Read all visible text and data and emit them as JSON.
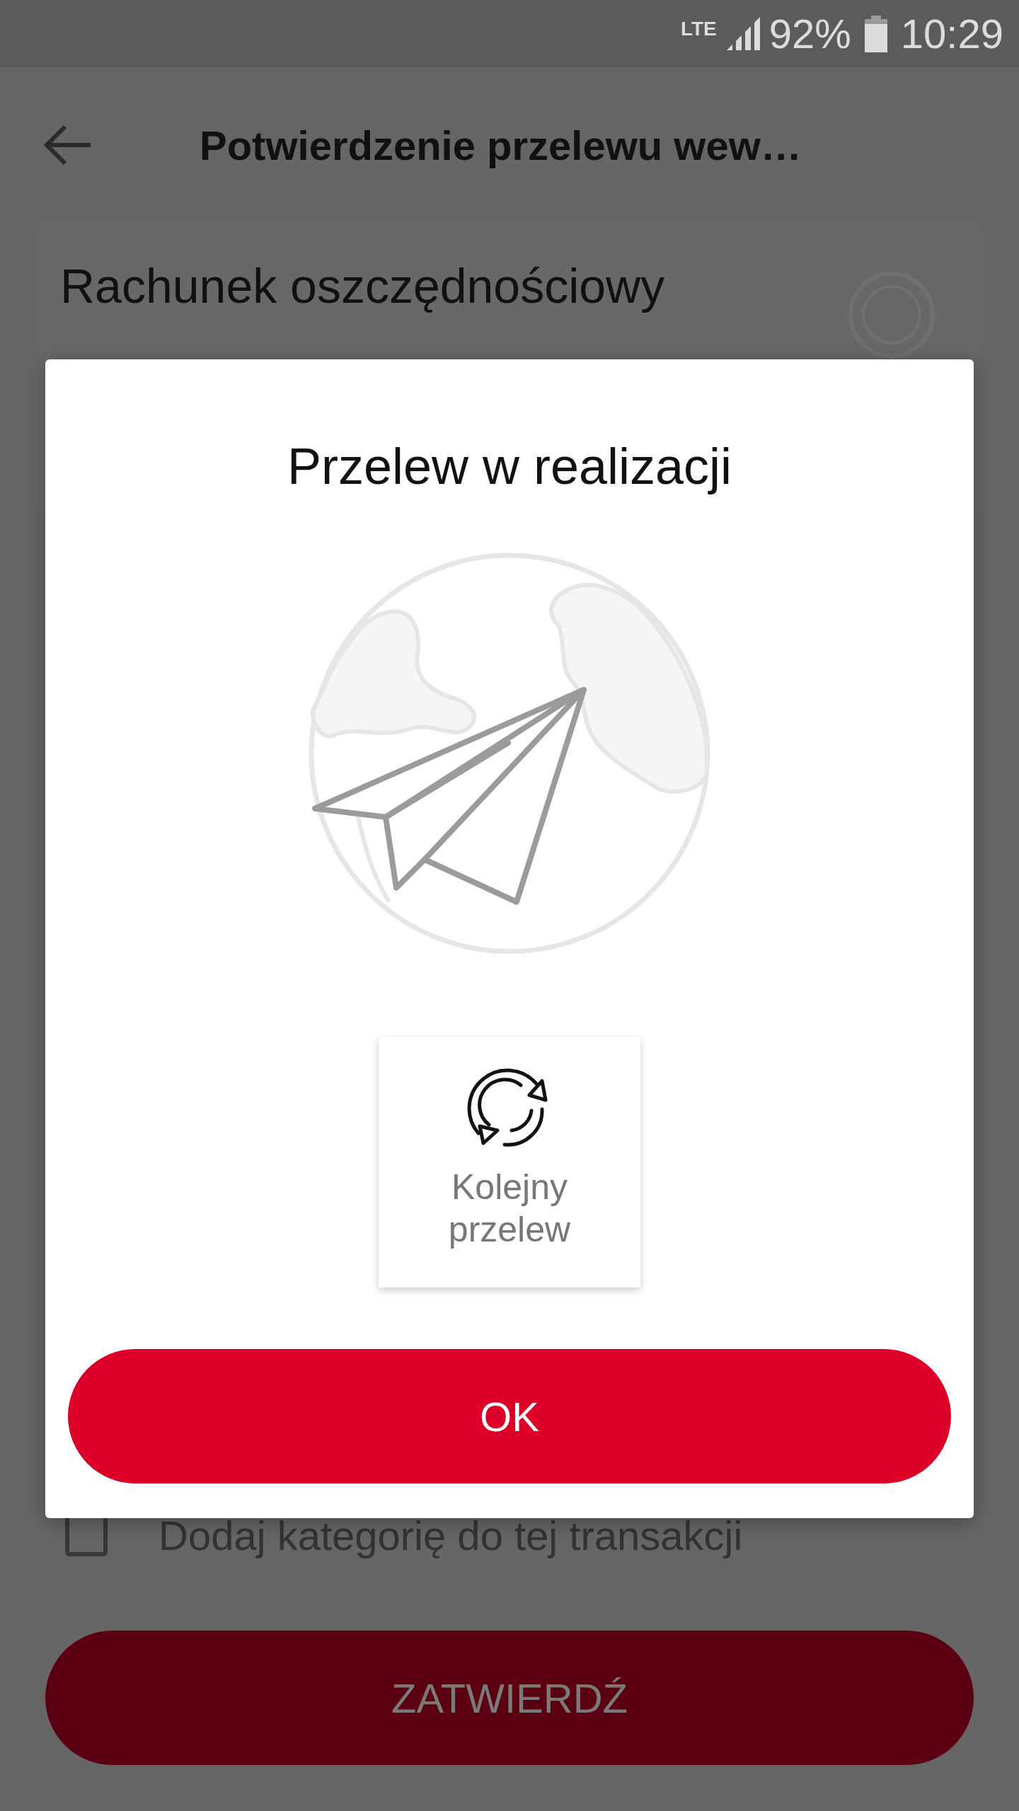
{
  "status_bar": {
    "network": "LTE",
    "battery": "92%",
    "time": "10:29"
  },
  "app_bar": {
    "title": "Potwierdzenie przelewu wew…"
  },
  "account_card": {
    "title": "Rachunek oszczędnościowy"
  },
  "category_option": {
    "label": "Dodaj kategorię do tej transakcji",
    "checked": false
  },
  "confirm_button": {
    "label": "ZATWIERDŹ"
  },
  "dialog": {
    "title": "Przelew w realizacji",
    "next_transfer": {
      "label": "Kolejny przelew"
    },
    "ok_button": {
      "label": "OK"
    }
  }
}
